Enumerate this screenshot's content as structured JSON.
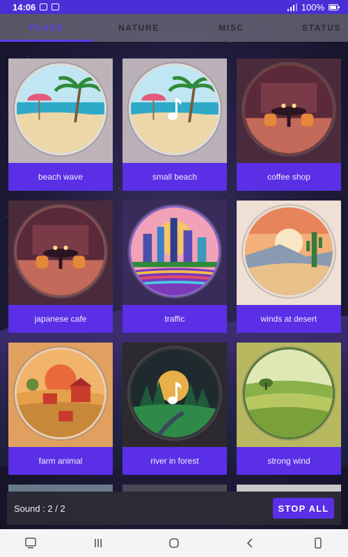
{
  "status_bar": {
    "time": "14:06",
    "battery": "100%"
  },
  "tabs": [
    {
      "label": "PLACE",
      "active": true
    },
    {
      "label": "NATURE",
      "active": false
    },
    {
      "label": "MISC",
      "active": false
    },
    {
      "label": "STATUS",
      "active": false
    }
  ],
  "cards": [
    {
      "label": "beach wave",
      "icon": "beach-scene-icon",
      "playing": false
    },
    {
      "label": "small beach",
      "icon": "beach-scene-icon",
      "playing": true
    },
    {
      "label": "coffee shop",
      "icon": "cafe-scene-icon",
      "playing": false
    },
    {
      "label": "japanese cafe",
      "icon": "cafe-scene-icon",
      "playing": false
    },
    {
      "label": "traffic",
      "icon": "city-scene-icon",
      "playing": false
    },
    {
      "label": "winds at desert",
      "icon": "desert-scene-icon",
      "playing": false
    },
    {
      "label": "farm animal",
      "icon": "farm-scene-icon",
      "playing": false
    },
    {
      "label": "river in forest",
      "icon": "forest-scene-icon",
      "playing": true
    },
    {
      "label": "strong wind",
      "icon": "meadow-scene-icon",
      "playing": false
    }
  ],
  "bottom_panel": {
    "sound_text": "Sound : 2 / 2",
    "stop_label": "STOP ALL"
  },
  "colors": {
    "accent": "#5a2fe6",
    "status_bar": "#4b2ed6",
    "tab_active": "#5a3df0"
  }
}
